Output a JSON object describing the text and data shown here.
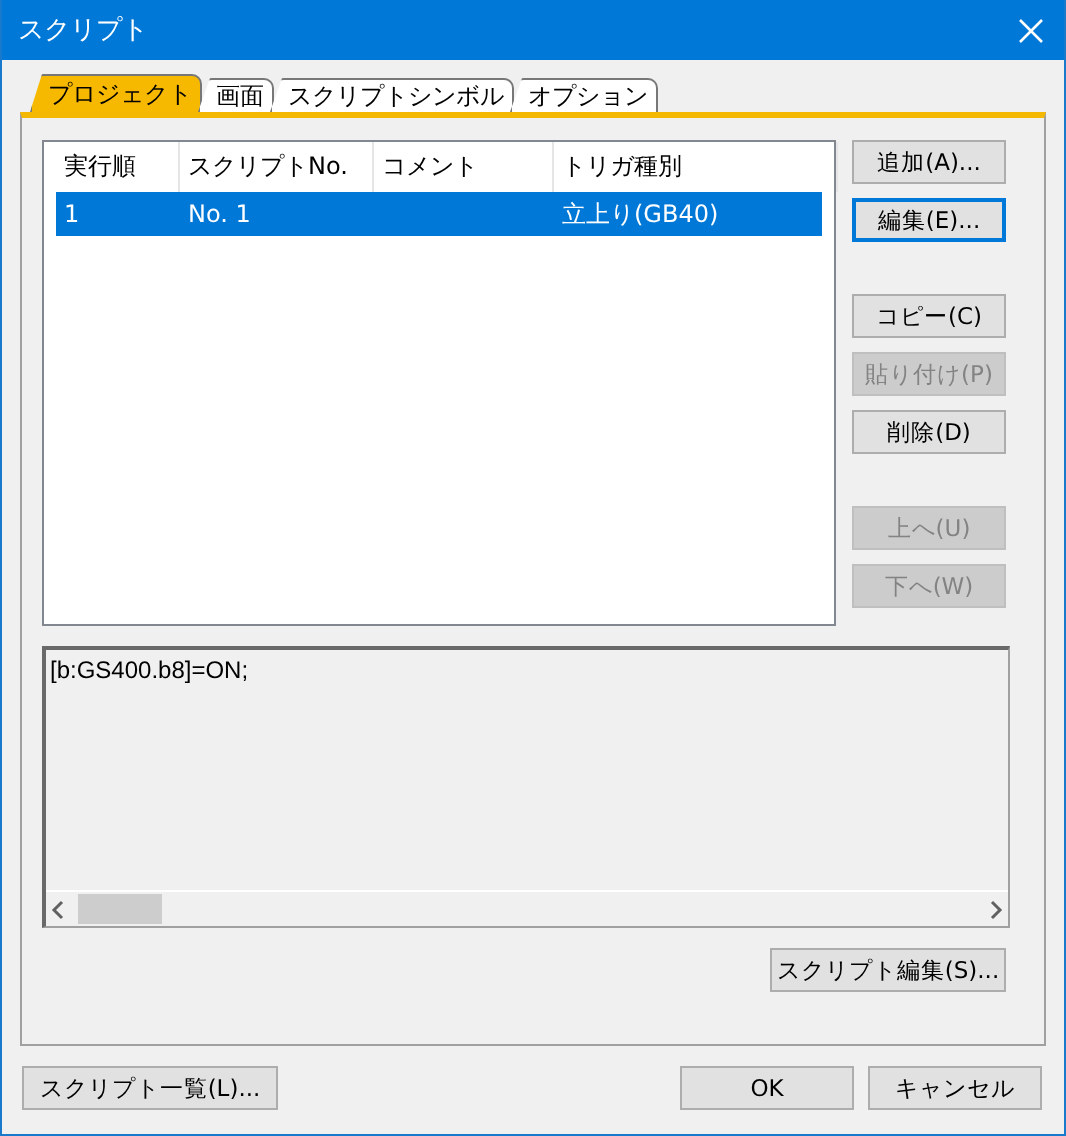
{
  "window": {
    "title": "スクリプト"
  },
  "tabs": [
    {
      "label": "プロジェクト",
      "selected": true
    },
    {
      "label": "画面",
      "selected": false
    },
    {
      "label": "スクリプトシンボル",
      "selected": false
    },
    {
      "label": "オプション",
      "selected": false
    }
  ],
  "list": {
    "columns": [
      "実行順",
      "スクリプトNo.",
      "コメント",
      "トリガ種別"
    ],
    "rows": [
      {
        "cells": [
          "1",
          "No. 1",
          "",
          "立上り(GB40)"
        ],
        "selected": true
      }
    ]
  },
  "side_button_groups": [
    [
      {
        "label": "追加(A)...",
        "disabled": false,
        "focused": false
      },
      {
        "label": "編集(E)...",
        "disabled": false,
        "focused": true
      }
    ],
    [
      {
        "label": "コピー(C)",
        "disabled": false,
        "focused": false
      },
      {
        "label": "貼り付け(P)",
        "disabled": true,
        "focused": false
      },
      {
        "label": "削除(D)",
        "disabled": false,
        "focused": false
      }
    ],
    [
      {
        "label": "上へ(U)",
        "disabled": true,
        "focused": false
      },
      {
        "label": "下へ(W)",
        "disabled": true,
        "focused": false
      }
    ]
  ],
  "script_text": "[b:GS400.b8]=ON;",
  "script_edit_button": "スクリプト編集(S)...",
  "footer": {
    "list_button": "スクリプト一覧(L)...",
    "ok": "OK",
    "cancel": "キャンセル"
  }
}
